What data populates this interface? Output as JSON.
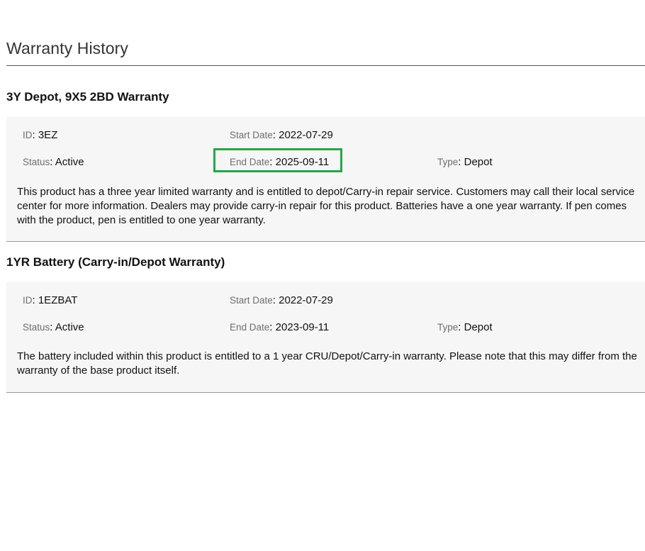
{
  "page": {
    "title": "Warranty History"
  },
  "labels": {
    "id": "ID",
    "start_date": "Start Date",
    "status": "Status",
    "end_date": "End Date",
    "type": "Type",
    "separator": ":"
  },
  "warranties": [
    {
      "name": "3Y Depot, 9X5 2BD Warranty",
      "id": "3EZ",
      "start_date": "2022-07-29",
      "status": "Active",
      "end_date": "2025-09-11",
      "end_date_highlighted": true,
      "type": "Depot",
      "description": "This product has a three year limited warranty and is entitled to depot/Carry-in repair service. Customers may call their local service center for more information. Dealers may provide carry-in repair for this product. Batteries have a one year warranty. If pen comes with the product, pen is entitled to one year warranty."
    },
    {
      "name": "1YR Battery (Carry-in/Depot Warranty)",
      "id": "1EZBAT",
      "start_date": "2022-07-29",
      "status": "Active",
      "end_date": "2023-09-11",
      "end_date_highlighted": false,
      "type": "Depot",
      "description": "The battery included within this product is entitled to a 1 year CRU/Depot/Carry-in warranty. Please note that this may differ from the warranty of the base product itself."
    }
  ],
  "colors": {
    "highlight": "#23a845",
    "panel_background": "#f6f6f6",
    "label_text": "#6e6e6e"
  }
}
